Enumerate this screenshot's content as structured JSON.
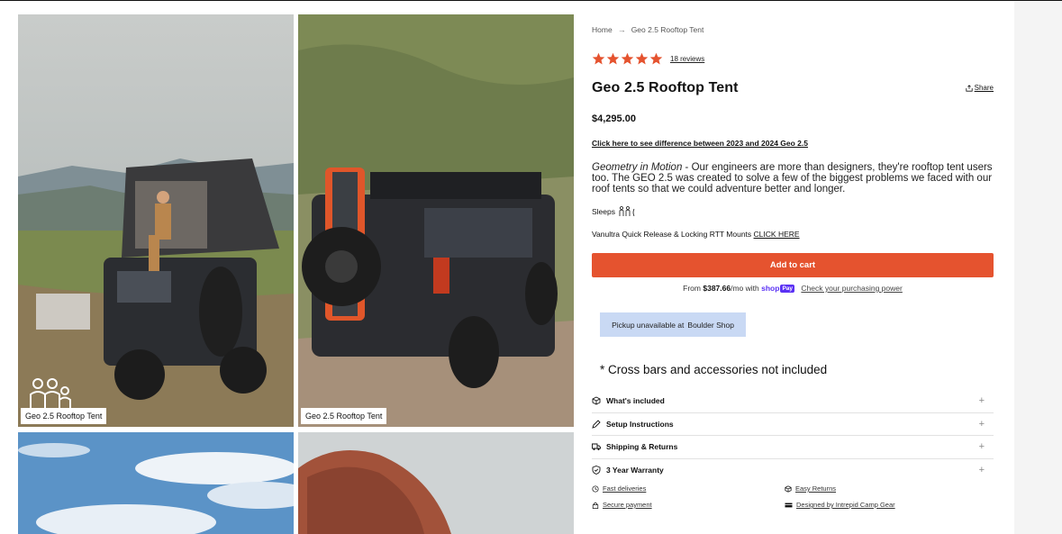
{
  "gallery": {
    "images": [
      {
        "caption": "Geo 2.5 Rooftop Tent"
      },
      {
        "caption": "Geo 2.5 Rooftop Tent"
      },
      {
        "caption": ""
      },
      {
        "caption": ""
      }
    ]
  },
  "breadcrumb": {
    "home": "Home",
    "current": "Geo 2.5 Rooftop Tent"
  },
  "rating": {
    "stars": 5,
    "reviews_label": "18 reviews"
  },
  "product": {
    "title": "Geo 2.5 Rooftop Tent",
    "share_label": "Share",
    "price": "$4,295.00",
    "diff_link": "Click here to see difference between 2023 and 2024 Geo 2.5",
    "desc_italic": "Geometry in Motion",
    "desc_body": " - Our engineers are more than designers, they're rooftop tent users too. The GEO 2.5 was created to solve a few of the biggest problems we faced with our roof tents so that we could adventure better and longer.",
    "sleeps_label": "Sleeps",
    "mounts_text": "Vanultra Quick Release & Locking RTT Mounts",
    "mounts_link": "CLICK HERE",
    "add_to_cart": "Add to cart",
    "finance_prefix": "From",
    "finance_amount": "$387.66",
    "finance_suffix": "/mo with",
    "shop_label": "shop",
    "pay_label": "Pay",
    "finance_check": "Check your purchasing power",
    "pickup_text": "Pickup unavailable at",
    "pickup_store": "Boulder Shop",
    "note": "* Cross bars and accessories not included"
  },
  "accordion": [
    {
      "label": "What's included",
      "icon": "box-icon"
    },
    {
      "label": "Setup Instructions",
      "icon": "pencil-icon"
    },
    {
      "label": "Shipping & Returns",
      "icon": "truck-icon"
    },
    {
      "label": "3 Year Warranty",
      "icon": "shield-icon"
    }
  ],
  "features": [
    {
      "label": "Fast deliveries",
      "icon": "clock-icon"
    },
    {
      "label": "Easy Returns",
      "icon": "box-icon"
    },
    {
      "label": "Secure payment",
      "icon": "lock-icon"
    },
    {
      "label": "Designed by Intrepid Camp Gear",
      "icon": "flag-icon"
    }
  ],
  "colors": {
    "accent": "#e5532f",
    "star": "#e5532f",
    "pickup_bg": "#c9d9f4",
    "shoppay": "#5a31f4"
  }
}
